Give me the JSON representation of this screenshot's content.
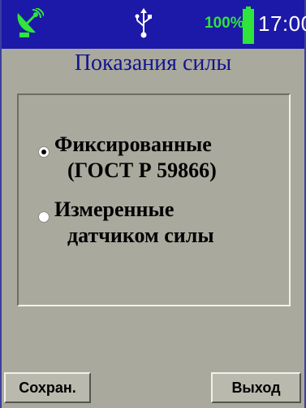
{
  "status_bar": {
    "battery_percent": "100%",
    "battery_level": 1.0,
    "time": "17:00",
    "icons": [
      "satellite-antenna-icon",
      "usb-icon",
      "battery-icon"
    ],
    "colors": {
      "background": "#1c19a8",
      "battery": "#2fe43a",
      "antenna": "#2fe43a"
    }
  },
  "title": "Показания силы",
  "options": [
    {
      "line1": "Фиксированные",
      "line2": "(ГОСТ Р 59866)",
      "selected": true
    },
    {
      "line1": "Измеренные",
      "line2": "датчиком силы",
      "selected": false
    }
  ],
  "buttons": {
    "save": "Сохран.",
    "exit": "Выход"
  },
  "colors": {
    "screen_background": "#a9a99e",
    "title": "#14148c"
  }
}
